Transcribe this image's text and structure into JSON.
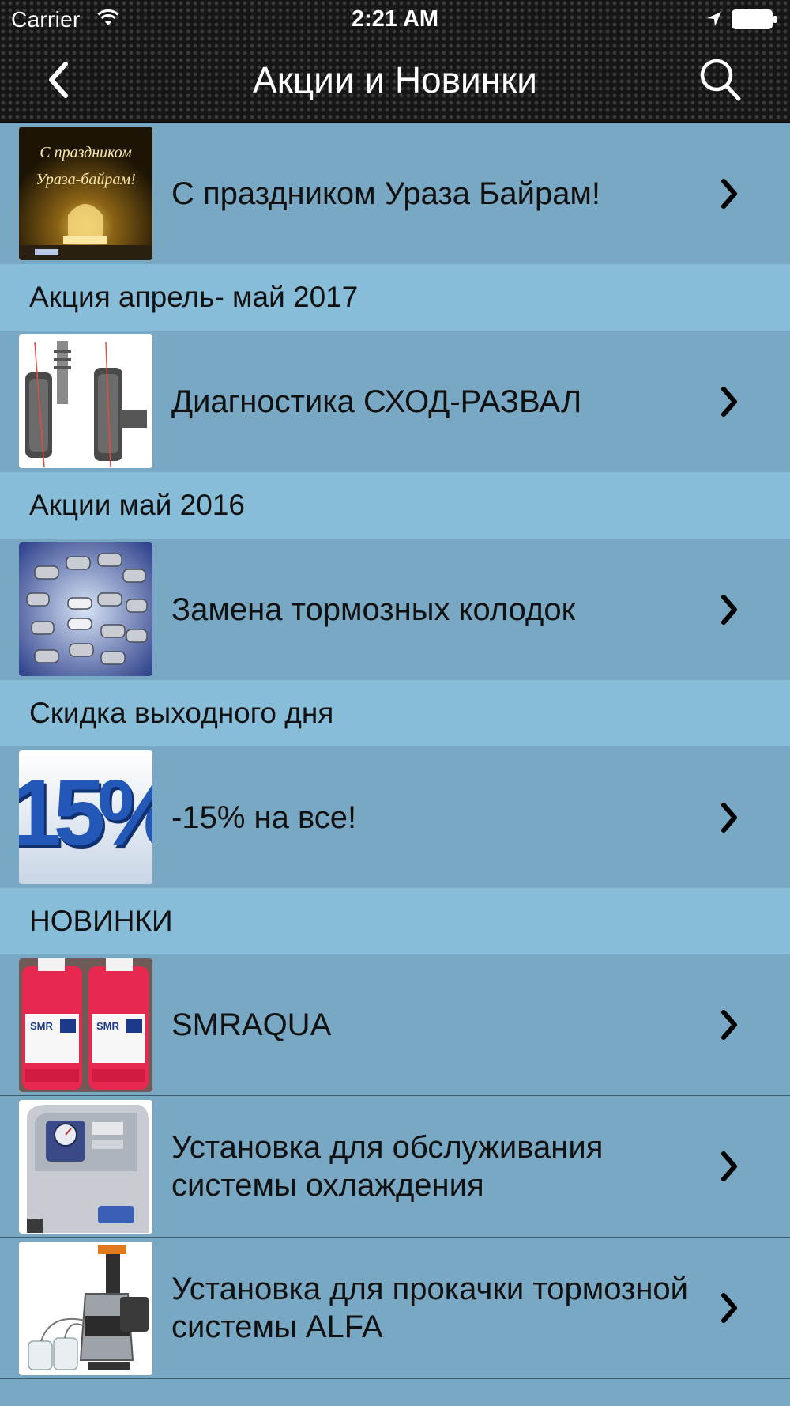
{
  "status": {
    "carrier": "Carrier",
    "time": "2:21 AM"
  },
  "nav": {
    "title": "Акции и Новинки",
    "back_icon": "chevron-left-icon",
    "search_icon": "search-icon"
  },
  "list": {
    "top_item": {
      "label": "С праздником Ураза Байрам!",
      "thumb_text_1": "С праздником",
      "thumb_text_2": "Ураза-байрам!"
    },
    "sections": [
      {
        "header": "Акция апрель- май 2017",
        "items": [
          {
            "label": "Диагностика СХОД-РАЗВАЛ"
          }
        ]
      },
      {
        "header": "Акции май 2016",
        "items": [
          {
            "label": "Замена тормозных колодок"
          }
        ]
      },
      {
        "header": "Скидка выходного дня",
        "items": [
          {
            "label": "-15% на все!",
            "thumb_text": "15%"
          }
        ]
      },
      {
        "header": "НОВИНКИ",
        "items": [
          {
            "label": "SMRAQUA"
          },
          {
            "label": "Установка для обслуживания системы охлаждения"
          },
          {
            "label": "Установка для прокачки тормозной системы ALFA"
          }
        ]
      }
    ]
  },
  "colors": {
    "header_bg": "#161616",
    "section_bg": "#87bdd8",
    "row_bg": "#78a8c3"
  }
}
